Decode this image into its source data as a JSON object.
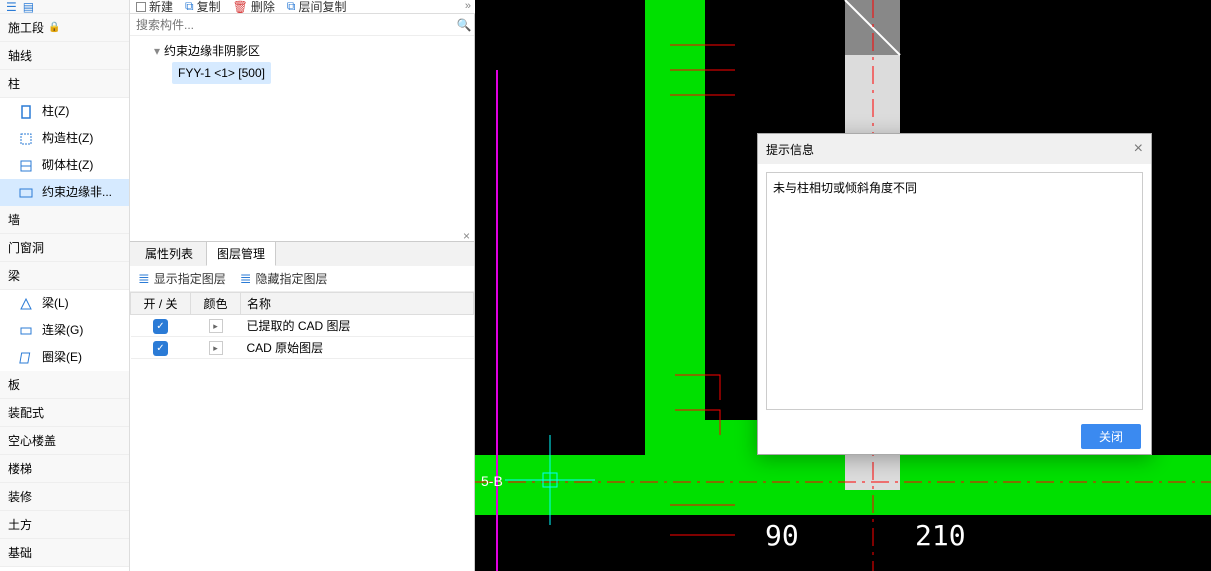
{
  "toolbar": {
    "new": "新建",
    "copy": "复制",
    "delete": "删除",
    "layercopy": "层间复制"
  },
  "search": {
    "placeholder": "搜索构件..."
  },
  "nav": {
    "sections": [
      "施工段",
      "轴线",
      "柱",
      "墙",
      "门窗洞",
      "梁",
      "板",
      "装配式",
      "空心楼盖",
      "楼梯",
      "装修",
      "土方",
      "基础"
    ],
    "column_items": [
      "柱(Z)",
      "构造柱(Z)",
      "砌体柱(Z)",
      "约束边缘非..."
    ],
    "beam_items": [
      "梁(L)",
      "连梁(G)",
      "圈梁(E)"
    ]
  },
  "tree": {
    "group": "约束边缘非阴影区",
    "leaf": "FYY-1 <1> [500]"
  },
  "tabs": {
    "attr": "属性列表",
    "layer": "图层管理"
  },
  "layer_toolbar": {
    "show": "显示指定图层",
    "hide": "隐藏指定图层"
  },
  "layer_table": {
    "headers": {
      "onoff": "开 / 关",
      "color": "颜色",
      "name": "名称"
    },
    "rows": [
      {
        "name": "已提取的 CAD 图层"
      },
      {
        "name": "CAD 原始图层"
      }
    ]
  },
  "dialog": {
    "title": "提示信息",
    "message": "未与柱相切或倾斜角度不同",
    "close_btn": "关闭"
  },
  "canvas_labels": {
    "axis": "5-B",
    "dim1": "90",
    "dim2": "210"
  }
}
